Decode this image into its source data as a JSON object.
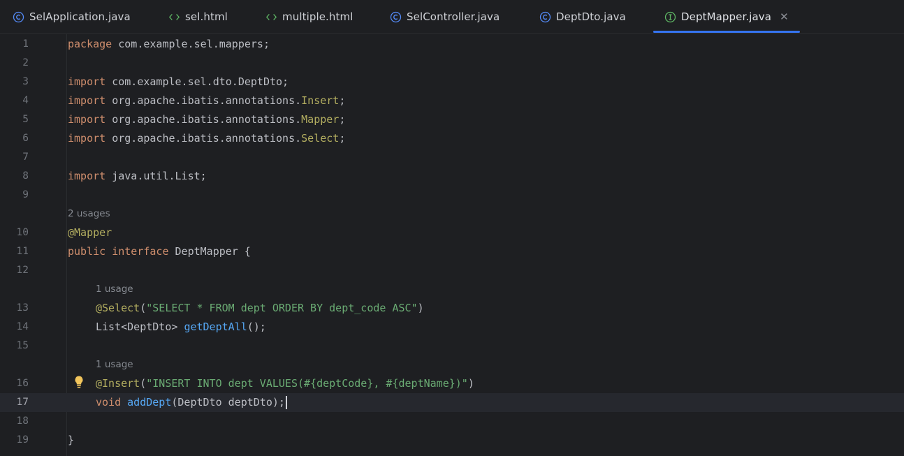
{
  "tabs": [
    {
      "label": "SelApplication.java",
      "icon": "class-icon"
    },
    {
      "label": "sel.html",
      "icon": "html-icon"
    },
    {
      "label": "multiple.html",
      "icon": "html-icon"
    },
    {
      "label": "SelController.java",
      "icon": "class-icon"
    },
    {
      "label": "DeptDto.java",
      "icon": "class-icon"
    },
    {
      "label": "DeptMapper.java",
      "icon": "interface-icon",
      "active": true
    }
  ],
  "hints": {
    "h1": "2 usages",
    "h2": "1 usage",
    "h3": "1 usage"
  },
  "line_numbers": [
    "1",
    "2",
    "3",
    "4",
    "5",
    "6",
    "7",
    "8",
    "9",
    "10",
    "11",
    "12",
    "13",
    "14",
    "15",
    "16",
    "17",
    "18",
    "19"
  ],
  "code": {
    "l1_kw": "package",
    "l1_rest": " com.example.sel.mappers;",
    "l3_kw": "import",
    "l3_rest": " com.example.sel.dto.DeptDto;",
    "l4_kw": "import",
    "l4_pre": " org.apache.ibatis.annotations.",
    "l4_cls": "Insert",
    "l4_end": ";",
    "l5_kw": "import",
    "l5_pre": " org.apache.ibatis.annotations.",
    "l5_cls": "Mapper",
    "l5_end": ";",
    "l6_kw": "import",
    "l6_pre": " org.apache.ibatis.annotations.",
    "l6_cls": "Select",
    "l6_end": ";",
    "l8_kw": "import",
    "l8_rest": " java.util.List;",
    "l10_ann": "@Mapper",
    "l11_kw1": "public",
    "l11_kw2": "interface",
    "l11_rest": " DeptMapper {",
    "l13_ann": "@Select",
    "l13_open": "(",
    "l13_str": "\"SELECT * FROM dept ORDER BY dept_code ASC\"",
    "l13_close": ")",
    "l14_pre": "List<DeptDto> ",
    "l14_fn": "getDeptAll",
    "l14_end": "();",
    "l16_ann": "@Insert",
    "l16_open": "(",
    "l16_str": "\"INSERT INTO dept VALUES(#{deptCode}, #{deptName})\"",
    "l16_close": ")",
    "l17_kw": "void",
    "l17_fn": "addDept",
    "l17_end": "(DeptDto deptDto);",
    "l19": "}"
  },
  "colors": {
    "accent": "#3574f0",
    "keyword": "#cf8e6d",
    "annotation": "#b3ae60",
    "string": "#6aab73",
    "function": "#56a8f5"
  }
}
